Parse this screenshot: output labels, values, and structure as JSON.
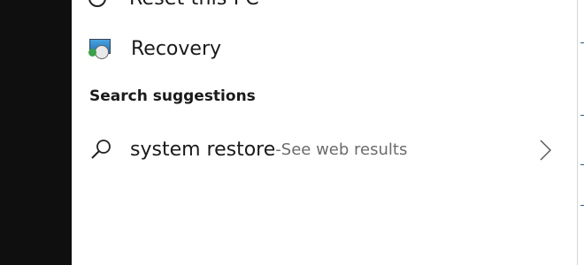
{
  "results": {
    "partial_item": {
      "label": "Reset this PC",
      "icon": "reset-icon"
    },
    "recovery_item": {
      "label": "Recovery",
      "icon": "recovery-icon"
    }
  },
  "suggestions": {
    "heading": "Search suggestions",
    "items": [
      {
        "query": "system restore",
        "separator": " - ",
        "action": "See web results",
        "icon": "search-icon",
        "trailing_icon": "chevron-right-icon"
      }
    ]
  },
  "colors": {
    "panel_background": "#ffffff",
    "taskbar_background": "#0f0f0f",
    "primary_text": "#1a1a1a",
    "secondary_text": "#6b6b6b"
  }
}
